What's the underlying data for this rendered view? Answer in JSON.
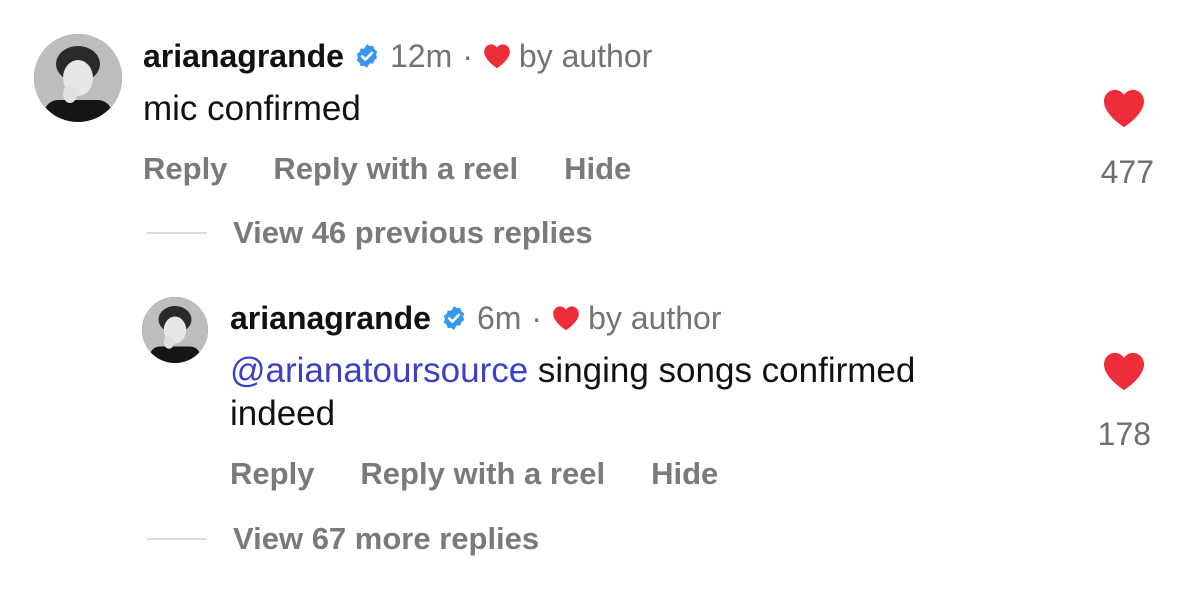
{
  "comments": [
    {
      "username": "arianagrande",
      "time": "12m",
      "separator": "·",
      "by_author": "by author",
      "mention": "",
      "text": "mic confirmed",
      "actions": {
        "reply": "Reply",
        "reply_reel": "Reply with a reel",
        "hide": "Hide"
      },
      "likes": "477"
    },
    {
      "username": "arianagrande",
      "time": "6m",
      "separator": "·",
      "by_author": "by author",
      "mention": "@arianatoursource",
      "text": " singing songs confirmed indeed",
      "actions": {
        "reply": "Reply",
        "reply_reel": "Reply with a reel",
        "hide": "Hide"
      },
      "likes": "178"
    }
  ],
  "view_previous": "View 46 previous replies",
  "view_more": "View 67 more replies",
  "colors": {
    "heart": "#ed2d3a",
    "verified": "#3797f0",
    "mention": "#3a40c7",
    "secondary_text": "#737373"
  },
  "icons": {
    "verified": "verified-badge-icon",
    "heart": "heart-icon"
  }
}
